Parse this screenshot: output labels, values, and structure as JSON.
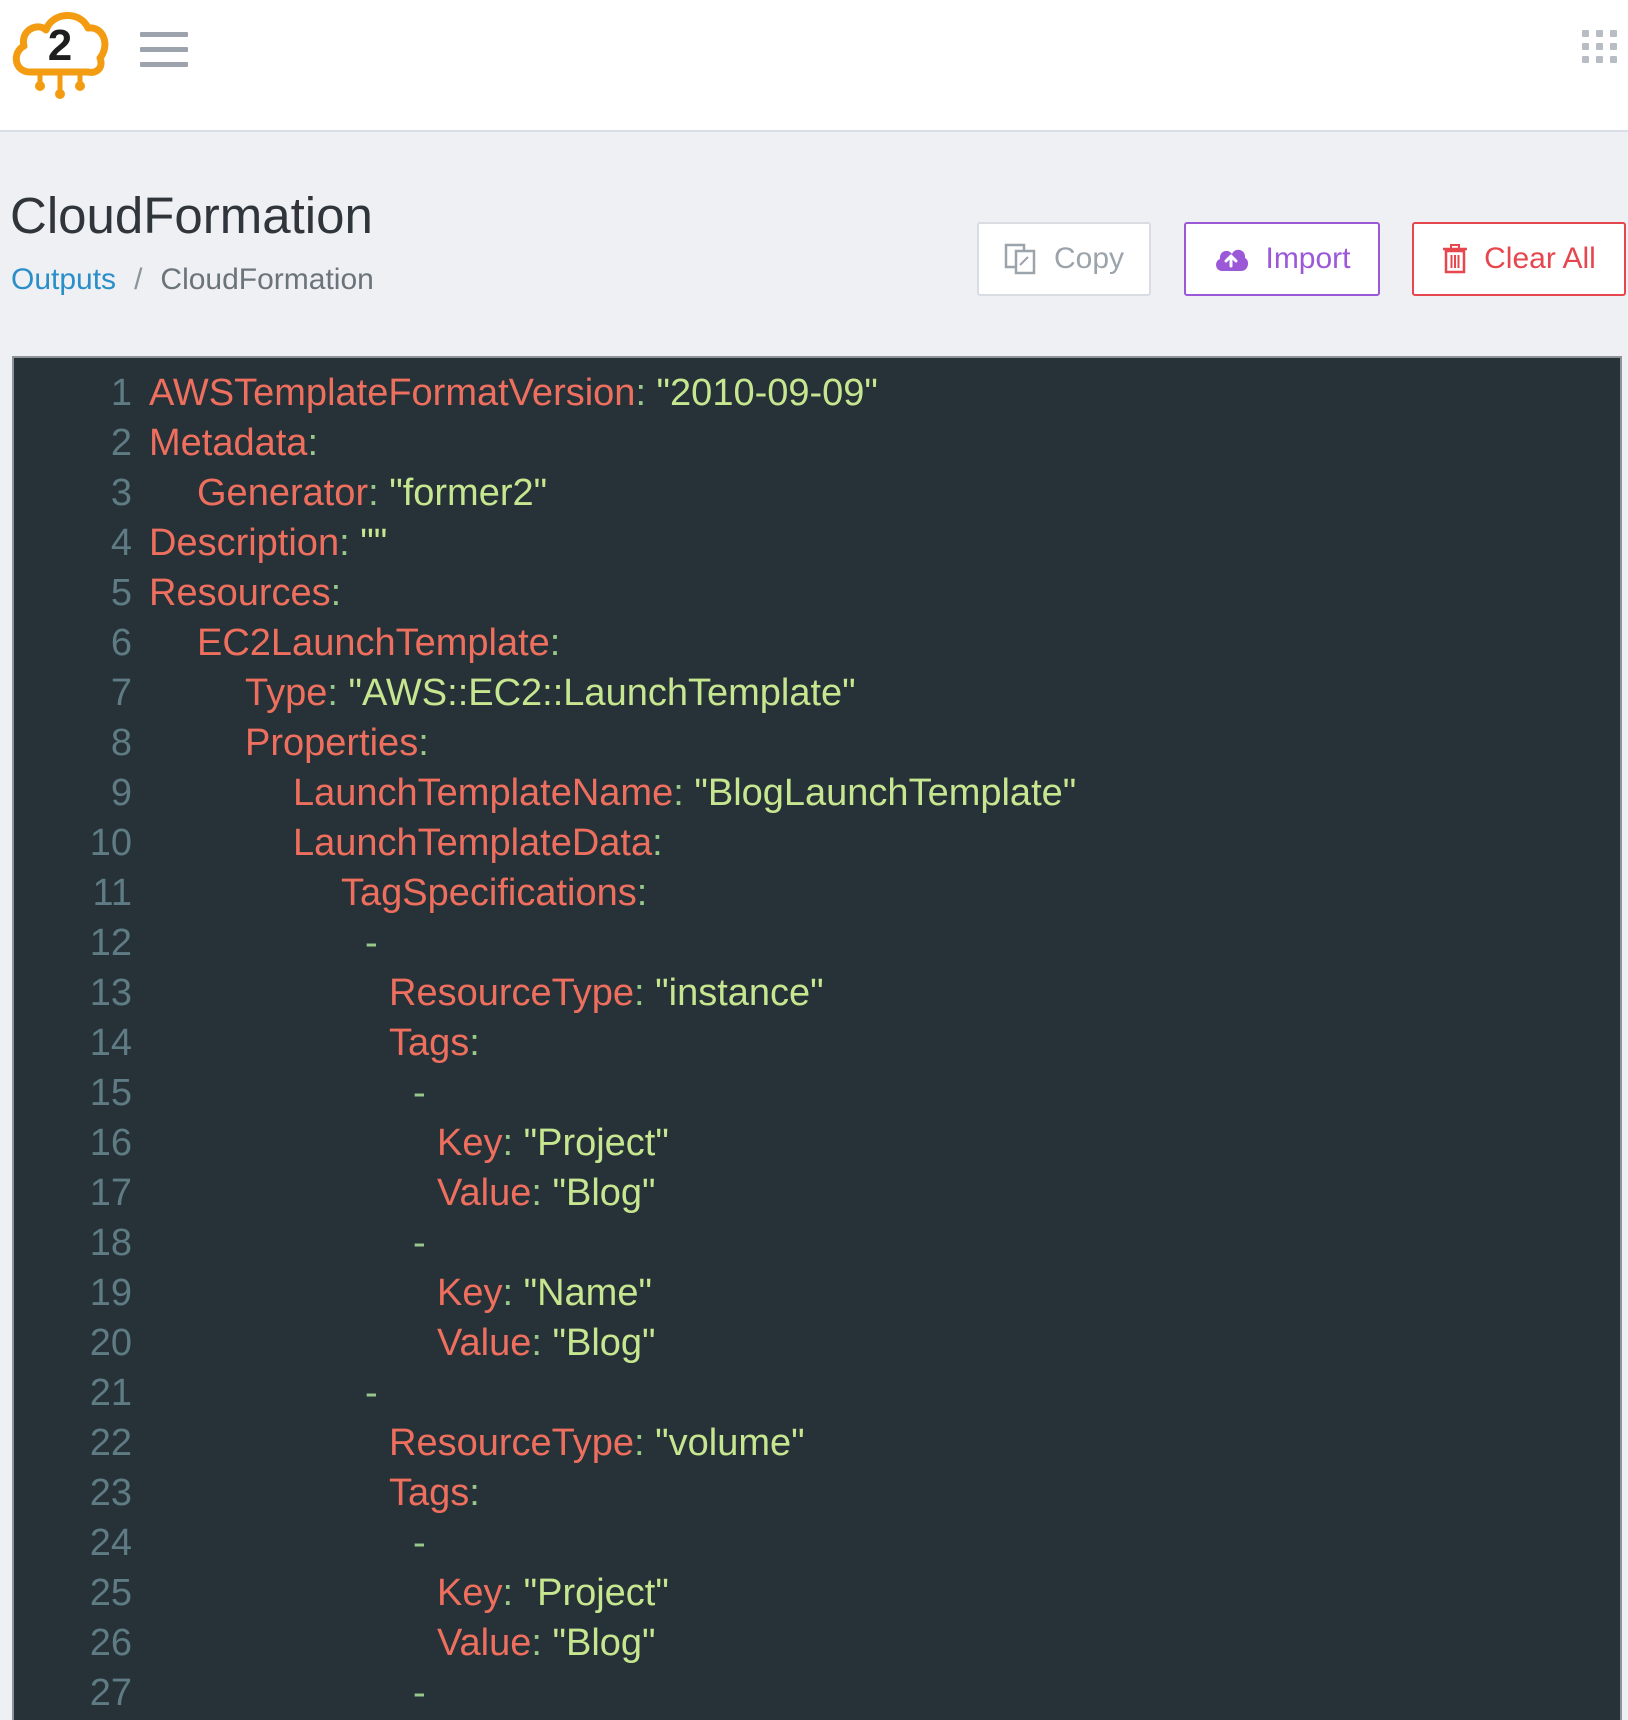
{
  "header": {
    "logo_char": "2",
    "menu_icon": "hamburger-menu-icon",
    "apps_icon": "apps-grid-icon"
  },
  "page": {
    "title": "CloudFormation",
    "breadcrumb": {
      "link": "Outputs",
      "separator": "/",
      "current": "CloudFormation"
    }
  },
  "toolbar": {
    "copy_label": "Copy",
    "import_label": "Import",
    "clear_label": "Clear All"
  },
  "colors": {
    "key": "#ef6f5e",
    "string": "#c6e68f",
    "punctuation": "#98c98a",
    "line_number": "#5f7b84",
    "editor_bg": "#263238",
    "import_accent": "#9b59d8",
    "clear_accent": "#e6474e",
    "link": "#2a8ec9",
    "logo": "#f39c12"
  },
  "editor": {
    "lines": [
      {
        "n": "1",
        "indent": 0,
        "key": "AWSTemplateFormatVersion",
        "colon": ":",
        "value": " \"2010-09-09\""
      },
      {
        "n": "2",
        "indent": 0,
        "key": "Metadata",
        "colon": ":",
        "value": ""
      },
      {
        "n": "3",
        "indent": 1,
        "key": "Generator",
        "colon": ":",
        "value": " \"former2\""
      },
      {
        "n": "4",
        "indent": 0,
        "key": "Description",
        "colon": ":",
        "value": " \"\""
      },
      {
        "n": "5",
        "indent": 0,
        "key": "Resources",
        "colon": ":",
        "value": ""
      },
      {
        "n": "6",
        "indent": 1,
        "key": "EC2LaunchTemplate",
        "colon": ":",
        "value": ""
      },
      {
        "n": "7",
        "indent": 2,
        "key": "Type",
        "colon": ":",
        "value": " \"AWS::EC2::LaunchTemplate\""
      },
      {
        "n": "8",
        "indent": 2,
        "key": "Properties",
        "colon": ":",
        "value": ""
      },
      {
        "n": "9",
        "indent": 3,
        "key": "LaunchTemplateName",
        "colon": ":",
        "value": " \"BlogLaunchTemplate\""
      },
      {
        "n": "10",
        "indent": 3,
        "key": "LaunchTemplateData",
        "colon": ":",
        "value": ""
      },
      {
        "n": "11",
        "indent": 4,
        "key": "TagSpecifications",
        "colon": ":",
        "value": ""
      },
      {
        "n": "12",
        "indent": 4.5,
        "key": "",
        "colon": "-",
        "value": ""
      },
      {
        "n": "13",
        "indent": 5,
        "key": "ResourceType",
        "colon": ":",
        "value": " \"instance\""
      },
      {
        "n": "14",
        "indent": 5,
        "key": "Tags",
        "colon": ":",
        "value": ""
      },
      {
        "n": "15",
        "indent": 5.5,
        "key": "",
        "colon": "-",
        "value": ""
      },
      {
        "n": "16",
        "indent": 6,
        "key": "Key",
        "colon": ":",
        "value": " \"Project\""
      },
      {
        "n": "17",
        "indent": 6,
        "key": "Value",
        "colon": ":",
        "value": " \"Blog\""
      },
      {
        "n": "18",
        "indent": 5.5,
        "key": "",
        "colon": "-",
        "value": ""
      },
      {
        "n": "19",
        "indent": 6,
        "key": "Key",
        "colon": ":",
        "value": " \"Name\""
      },
      {
        "n": "20",
        "indent": 6,
        "key": "Value",
        "colon": ":",
        "value": " \"Blog\""
      },
      {
        "n": "21",
        "indent": 4.5,
        "key": "",
        "colon": "-",
        "value": ""
      },
      {
        "n": "22",
        "indent": 5,
        "key": "ResourceType",
        "colon": ":",
        "value": " \"volume\""
      },
      {
        "n": "23",
        "indent": 5,
        "key": "Tags",
        "colon": ":",
        "value": ""
      },
      {
        "n": "24",
        "indent": 5.5,
        "key": "",
        "colon": "-",
        "value": ""
      },
      {
        "n": "25",
        "indent": 6,
        "key": "Key",
        "colon": ":",
        "value": " \"Project\""
      },
      {
        "n": "26",
        "indent": 6,
        "key": "Value",
        "colon": ":",
        "value": " \"Blog\""
      },
      {
        "n": "27",
        "indent": 5.5,
        "key": "",
        "colon": "-",
        "value": ""
      }
    ]
  }
}
